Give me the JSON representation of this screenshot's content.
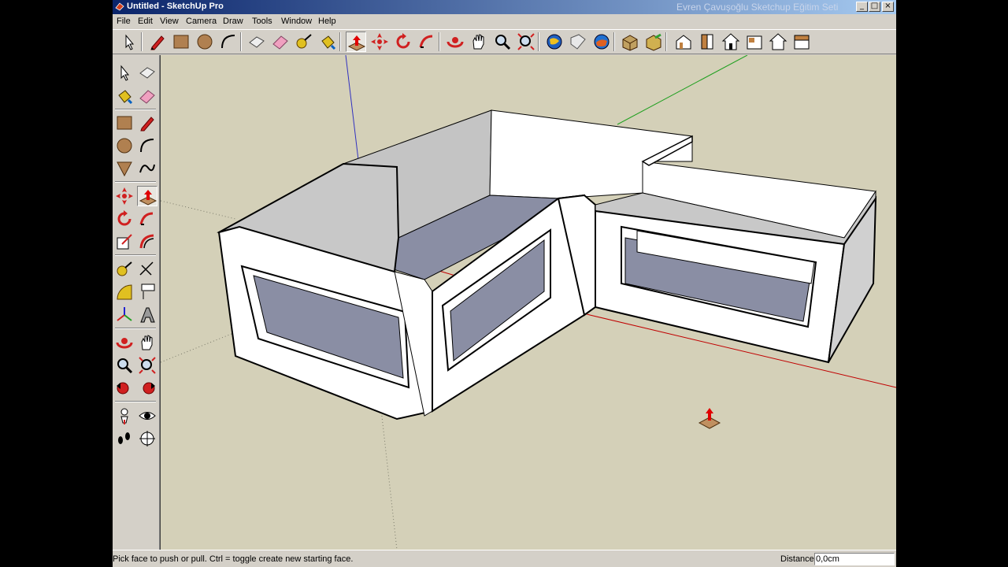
{
  "window": {
    "title": "Untitled - SketchUp Pro",
    "overlay_caption": "Evren Çavuşoğlu Sketchup Eğitim Seti",
    "controls": {
      "minimize": "_",
      "maximize": "□",
      "close": "×"
    }
  },
  "menu": [
    "File",
    "Edit",
    "View",
    "Camera",
    "Draw",
    "Tools",
    "Window",
    "Help"
  ],
  "toolbar_icons": [
    "select-icon",
    "pencil-icon",
    "rectangle-icon",
    "circle-icon",
    "arc-icon",
    "make-component-icon",
    "eraser-icon",
    "tape-measure-icon",
    "paint-bucket-icon",
    "push-pull-icon",
    "move-icon",
    "rotate-icon",
    "follow-me-icon",
    "orbit-icon",
    "pan-icon",
    "zoom-icon",
    "zoom-extents-icon",
    "get-models-icon",
    "share-model-icon",
    "google-earth-icon",
    "components-icon",
    "materials-icon",
    "iso-view-icon",
    "front-view-icon",
    "top-view-icon",
    "right-view-icon",
    "back-view-icon",
    "left-view-icon"
  ],
  "left_toolbar_icons": [
    [
      "select-icon",
      "make-component-icon"
    ],
    [
      "paint-bucket-icon",
      "eraser-icon"
    ],
    [
      "rectangle-icon",
      "line-icon"
    ],
    [
      "circle-icon",
      "arc-icon"
    ],
    [
      "polygon-icon",
      "freehand-icon"
    ],
    [
      "move-icon",
      "push-pull-icon"
    ],
    [
      "rotate-icon",
      "follow-me-icon"
    ],
    [
      "scale-icon",
      "offset-icon"
    ],
    [
      "tape-measure-icon",
      "dimension-icon"
    ],
    [
      "protractor-icon",
      "text-icon"
    ],
    [
      "axes-icon",
      "3d-text-icon"
    ],
    [
      "orbit-icon",
      "pan-icon"
    ],
    [
      "zoom-icon",
      "zoom-window-icon"
    ],
    [
      "previous-view-icon",
      "next-view-icon"
    ],
    [
      "position-camera-icon",
      "look-around-icon"
    ],
    [
      "walk-icon",
      "section-plane-icon"
    ]
  ],
  "active_tool": "push-pull-icon",
  "colors": {
    "titlebar_start": "#0a246a",
    "titlebar_end": "#a6caf0",
    "viewport_bg": "#d4d0b8",
    "wall_face": "#ffffff",
    "floor_face": "#8a8ea4",
    "axis_red": "#c00000",
    "axis_green": "#00a000",
    "axis_blue": "#0000c0"
  },
  "status": {
    "message": "Pick face to push or pull.  Ctrl = toggle create new starting face.",
    "vcb_label": "Distance",
    "vcb_value": "0,0cm"
  }
}
